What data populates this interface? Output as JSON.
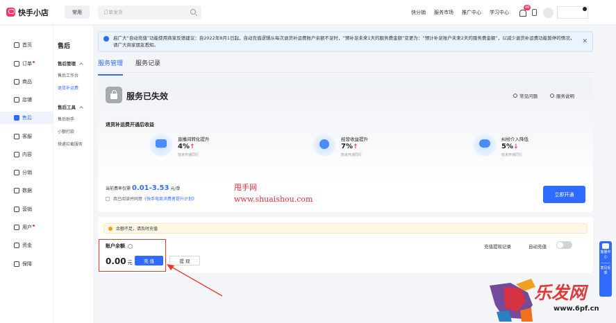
{
  "app": {
    "title": "快手小店",
    "common_label": "常用"
  },
  "search": {
    "placeholder": "订单发货"
  },
  "top_nav": [
    "快分销",
    "服务市场",
    "推广中心",
    "学习中心"
  ],
  "bell_badge": "46",
  "sidebar": {
    "items": [
      {
        "label": "首页",
        "dot": false
      },
      {
        "label": "订单",
        "dot": true
      },
      {
        "label": "商品",
        "dot": false
      },
      {
        "label": "店铺",
        "dot": false
      },
      {
        "label": "售后",
        "dot": false,
        "active": true
      },
      {
        "label": "客服",
        "dot": false
      },
      {
        "label": "内容",
        "dot": false
      },
      {
        "label": "分销",
        "dot": false
      },
      {
        "label": "数据",
        "dot": false
      },
      {
        "label": "营销",
        "dot": false
      },
      {
        "label": "用户",
        "dot": true
      },
      {
        "label": "资金",
        "dot": false
      },
      {
        "label": "保障",
        "dot": false
      }
    ]
  },
  "subnav": {
    "title": "售后",
    "groups": [
      {
        "label": "售后管理",
        "items": [
          "售后工作台",
          "退货补运费"
        ]
      },
      {
        "label": "售后工具",
        "items": [
          "售后助手",
          "小额打款",
          "快递拦截服务"
        ]
      }
    ],
    "active_item": "退货补运费"
  },
  "notice": {
    "text": "启广大“自动充值”功能使用商家反馈建议：自2022年8月1日起，自动充值逻辑从每次退货补运费账户余额不足时，“预补足未来1天的服务费金额”变更为：“预计补足账户未来2天的服务费金额”，以减少退货补运费功能暂停的情况，请广大商家朋友悉知。"
  },
  "tabs": [
    {
      "label": "服务管理",
      "active": true
    },
    {
      "label": "服务记录",
      "active": false
    }
  ],
  "status": {
    "title": "服务已失效",
    "faq_label": "常见问题",
    "guide_label": "服务说明"
  },
  "benefits": {
    "title": "退货补运费开通后收益",
    "items": [
      {
        "name": "直播间转化提升",
        "value": "4%",
        "arrow": "↑",
        "note": "较未开通同行"
      },
      {
        "name": "经营收益提升",
        "value": "7%",
        "arrow": "↑",
        "note": "较未开通同行"
      },
      {
        "name": "纠纷介入降低",
        "value": "5%",
        "arrow": "↓",
        "note": "较未开通同行"
      }
    ]
  },
  "rate": {
    "prefix": "当前费率仅需",
    "value": "0.01-3.53",
    "unit": "元/单"
  },
  "agree": {
    "prefix": "我已阅读并同意",
    "link": "《快手电商消费者提升计划》"
  },
  "open_button": "立即开通",
  "watermark": {
    "line1": "甩手网",
    "line2": "www.shuaishou.com"
  },
  "account": {
    "warning": "余额不足，请及时充值",
    "balance_label": "账户余额",
    "balance_value": "0.00",
    "balance_unit": "元",
    "recharge_label": "充 值",
    "withdraw_label": "提 现",
    "record_link": "充值提现记录",
    "auto_label": "自动充值"
  },
  "side_float": [
    "客服中心",
    "意见反馈"
  ],
  "brand_watermark": {
    "text": "乐发网",
    "url": "www.6pf.cn"
  },
  "colors": {
    "accent": "#2f6bff",
    "brand": "#fe3666",
    "annotation": "#e8392b"
  }
}
